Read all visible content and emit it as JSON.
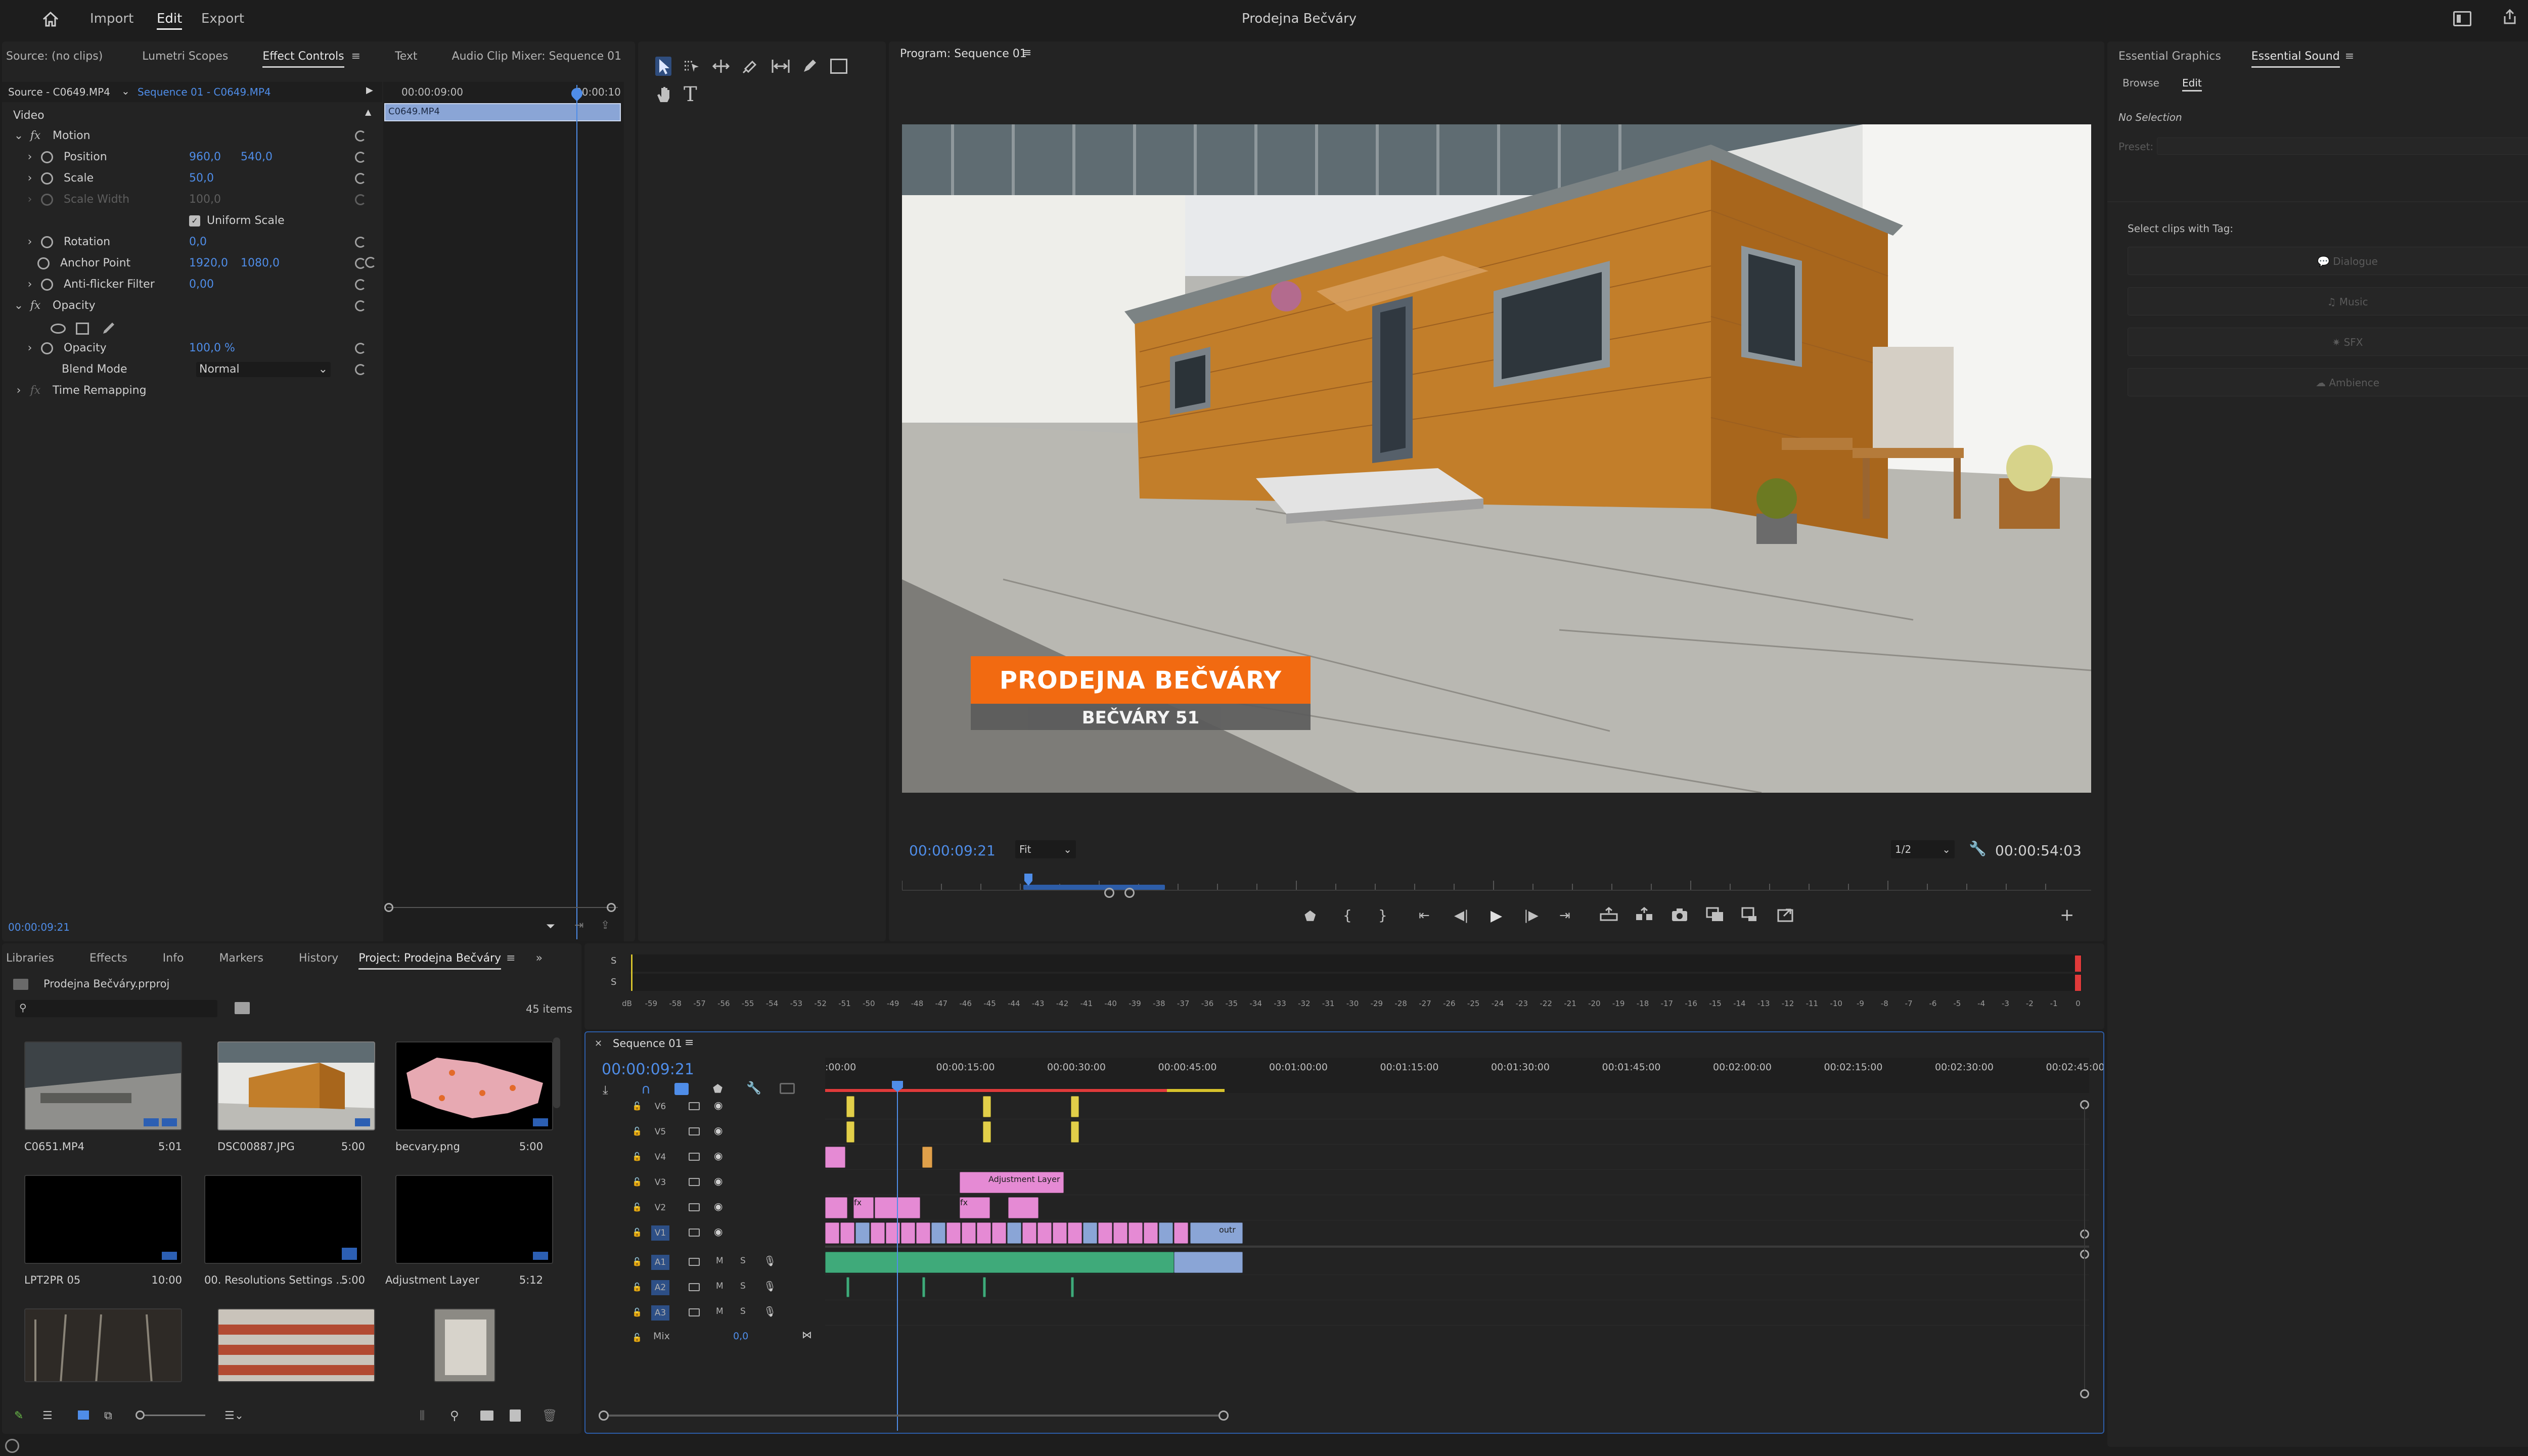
{
  "topbar": {
    "home_icon": "home-icon",
    "menu": [
      "Import",
      "Edit",
      "Export"
    ],
    "active_menu": "Edit",
    "title": "Prodejna Bečváry"
  },
  "source_panel": {
    "tabs": [
      "Source: (no clips)",
      "Lumetri Scopes",
      "Effect Controls",
      "Text",
      "Audio Clip Mixer: Sequence 01"
    ],
    "active_tab": "Effect Controls",
    "master_label": "Source - C0649.MP4",
    "sequence_label": "Sequence 01 - C0649.MP4",
    "timecode_ruler": "00:00:09:00",
    "timecode_ruler2": "00:00:10",
    "clip_name": "C0649.MP4",
    "video_section": "Video",
    "motion": "Motion",
    "position_label": "Position",
    "position_x": "960,0",
    "position_y": "540,0",
    "scale_label": "Scale",
    "scale_val": "50,0",
    "scale_width_label": "Scale Width",
    "scale_width_val": "100,0",
    "uniform_scale": "Uniform Scale",
    "rotation_label": "Rotation",
    "rotation_val": "0,0",
    "anchor_label": "Anchor Point",
    "anchor_x": "1920,0",
    "anchor_y": "1080,0",
    "antiflicker_label": "Anti-flicker Filter",
    "antiflicker_val": "0,00",
    "opacity_section": "Opacity",
    "opacity_label": "Opacity",
    "opacity_val": "100,0 %",
    "blend_label": "Blend Mode",
    "blend_val": "Normal",
    "time_remap": "Time Remapping",
    "current_time": "00:00:09:21"
  },
  "program": {
    "title": "Program: Sequence 01",
    "timecode": "00:00:09:21",
    "fit": "Fit",
    "quality": "1/2",
    "duration": "00:00:54:03",
    "lower_third_title": "PRODEJNA BEČVÁRY",
    "lower_third_sub": "BEČVÁRY 51"
  },
  "essential": {
    "tabs": [
      "Essential Graphics",
      "Essential Sound"
    ],
    "active_tab": "Essential Sound",
    "subtabs": [
      "Browse",
      "Edit"
    ],
    "active_subtab": "Edit",
    "no_selection": "No Selection",
    "preset_label": "Preset:",
    "select_clips": "Select clips with Tag:",
    "tags": [
      "Dialogue",
      "Music",
      "SFX",
      "Ambience"
    ]
  },
  "project": {
    "tabs": [
      "Libraries",
      "Effects",
      "Info",
      "Markers",
      "History",
      "Project: Prodejna Bečváry"
    ],
    "active_tab": "Project: Prodejna Bečváry",
    "file": "Prodejna Bečváry.prproj",
    "items_count": "45 items",
    "items": [
      {
        "name": "C0651.MP4",
        "dur": "5:01"
      },
      {
        "name": "DSC00887.JPG",
        "dur": "5:00"
      },
      {
        "name": "becvary.png",
        "dur": "5:00"
      },
      {
        "name": "LPT2PR 05",
        "dur": "10:00"
      },
      {
        "name": "00. Resolutions Settings ...",
        "dur": "5:00"
      },
      {
        "name": "Adjustment Layer",
        "dur": "5:12"
      }
    ]
  },
  "meters": {
    "scale": [
      "dB",
      "-59",
      "-58",
      "-57",
      "-56",
      "-55",
      "-54",
      "-53",
      "-52",
      "-51",
      "-50",
      "-49",
      "-48",
      "-47",
      "-46",
      "-45",
      "-44",
      "-43",
      "-42",
      "-41",
      "-40",
      "-39",
      "-38",
      "-37",
      "-36",
      "-35",
      "-34",
      "-33",
      "-32",
      "-31",
      "-30",
      "-29",
      "-28",
      "-27",
      "-26",
      "-25",
      "-24",
      "-23",
      "-22",
      "-21",
      "-20",
      "-19",
      "-18",
      "-17",
      "-16",
      "-15",
      "-14",
      "-13",
      "-12",
      "-11",
      "-10",
      "-9",
      "-8",
      "-7",
      "-6",
      "-5",
      "-4",
      "-3",
      "-2",
      "-1",
      "0"
    ],
    "ch_labels": [
      "S",
      "S"
    ]
  },
  "timeline": {
    "title": "Sequence 01",
    "timecode": "00:00:09:21",
    "ruler": [
      ":00:00",
      "00:00:15:00",
      "00:00:30:00",
      "00:00:45:00",
      "00:01:00:00",
      "00:01:15:00",
      "00:01:30:00",
      "00:01:45:00",
      "00:02:00:00",
      "00:02:15:00",
      "00:02:30:00",
      "00:02:45:00"
    ],
    "video_tracks": [
      "V6",
      "V5",
      "V4",
      "V3",
      "V2",
      "V1"
    ],
    "audio_tracks": [
      "A1",
      "A2",
      "A3"
    ],
    "mix_label": "Mix",
    "mix_val": "0,0",
    "adjustment_clip": "Adjustment Layer",
    "outro_clip": "outr",
    "fx_badge": "fx",
    "m": "M",
    "s": "S"
  }
}
